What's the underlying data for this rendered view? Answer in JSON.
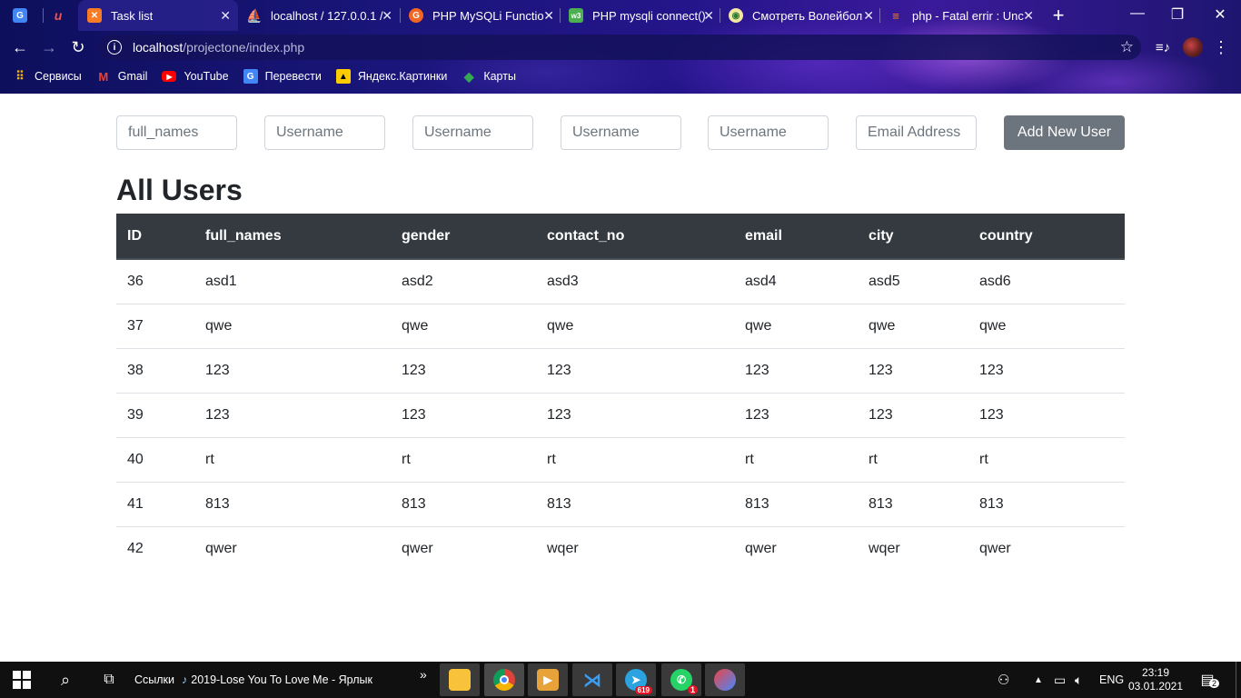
{
  "browser": {
    "tabs": [
      {
        "title": "",
        "icon": "google-translate-icon"
      },
      {
        "title": "",
        "icon": "udemy-icon"
      },
      {
        "title": "Task list",
        "icon": "xampp-icon",
        "active": true
      },
      {
        "title": "localhost / 127.0.0.1 /",
        "icon": "phpmyadmin-icon"
      },
      {
        "title": "PHP MySQLi Functio",
        "icon": "w3-icon"
      },
      {
        "title": "PHP mysqli connect()",
        "icon": "w3resource-icon"
      },
      {
        "title": "Смотреть Волейбол",
        "icon": "volleyball-icon"
      },
      {
        "title": "php - Fatal errir : Unc",
        "icon": "stackoverflow-icon"
      }
    ],
    "new_tab": "+",
    "window_controls": {
      "minimize": "—",
      "restore": "❐",
      "close": "✕"
    },
    "url_host": "localhost",
    "url_path": "/projectone/index.php",
    "bookmarks": [
      {
        "label": "Сервисы",
        "icon": "apps-grid-icon"
      },
      {
        "label": "Gmail",
        "icon": "gmail-icon"
      },
      {
        "label": "YouTube",
        "icon": "youtube-icon"
      },
      {
        "label": "Перевести",
        "icon": "translate-icon"
      },
      {
        "label": "Яндекс.Картинки",
        "icon": "yandex-images-icon"
      },
      {
        "label": "Карты",
        "icon": "maps-icon"
      }
    ]
  },
  "form": {
    "full_names_placeholder": "full_names",
    "field2_placeholder": "Username",
    "field3_placeholder": "Username",
    "field4_placeholder": "Username",
    "field5_placeholder": "Username",
    "email_placeholder": "Email Address",
    "submit_label": "Add New User"
  },
  "heading": "All Users",
  "table": {
    "columns": [
      "ID",
      "full_names",
      "gender",
      "contact_no",
      "email",
      "city",
      "country"
    ],
    "rows": [
      [
        "36",
        "asd1",
        "asd2",
        "asd3",
        "asd4",
        "asd5",
        "asd6"
      ],
      [
        "37",
        "qwe",
        "qwe",
        "qwe",
        "qwe",
        "qwe",
        "qwe"
      ],
      [
        "38",
        "123",
        "123",
        "123",
        "123",
        "123",
        "123"
      ],
      [
        "39",
        "123",
        "123",
        "123",
        "123",
        "123",
        "123"
      ],
      [
        "40",
        "rt",
        "rt",
        "rt",
        "rt",
        "rt",
        "rt"
      ],
      [
        "41",
        "813",
        "813",
        "813",
        "813",
        "813",
        "813"
      ],
      [
        "42",
        "qwer",
        "qwer",
        "wqer",
        "qwer",
        "wqer",
        "qwer"
      ]
    ]
  },
  "taskbar": {
    "links_label": "Ссылки",
    "pinned_file": "2019-Lose You To Love Me - Ярлык",
    "overflow": "»",
    "telegram_badge": "619",
    "whatsapp_badge": "1",
    "language": "ENG",
    "time": "23:19",
    "date": "03.01.2021",
    "notification_count": "2"
  }
}
